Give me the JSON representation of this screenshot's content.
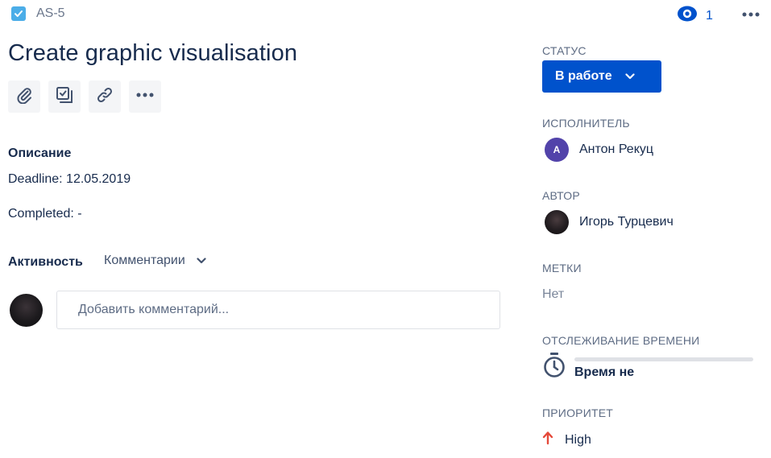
{
  "header": {
    "issue_key": "AS-5",
    "watch_count": "1",
    "issue_type_icon": "checkbox-icon",
    "watch_icon": "eye-icon",
    "more_icon": "ellipsis-icon"
  },
  "issue": {
    "title": "Create graphic visualisation"
  },
  "actions": [
    {
      "name": "attachment-icon"
    },
    {
      "name": "subtask-icon"
    },
    {
      "name": "link-icon"
    },
    {
      "name": "ellipsis-icon"
    }
  ],
  "description": {
    "heading": "Описание",
    "lines": [
      "Deadline: 12.05.2019",
      "Completed: -"
    ]
  },
  "activity": {
    "label": "Активность",
    "filter": "Комментарии",
    "comment_placeholder": "Добавить комментарий..."
  },
  "sidebar": {
    "status": {
      "label": "СТАТУС",
      "value": "В работе"
    },
    "assignee": {
      "label": "ИСПОЛНИТЕЛЬ",
      "initial": "A",
      "name": "Антон Рекуц"
    },
    "reporter": {
      "label": "АВТОР",
      "name": "Игорь Турцевич"
    },
    "labels": {
      "label": "МЕТКИ",
      "value": "Нет"
    },
    "time_tracking": {
      "label": "ОТСЛЕЖИВАНИЕ ВРЕМЕНИ",
      "value": "Время не",
      "progress": 0
    },
    "priority": {
      "label": "ПРИОРИТЕТ",
      "value": "High",
      "icon": "arrow-up-icon"
    }
  },
  "colors": {
    "accent": "#0052cc",
    "issue_type": "#4bade8",
    "assignee_avatar": "#5243aa",
    "priority_high": "#e5493a"
  }
}
